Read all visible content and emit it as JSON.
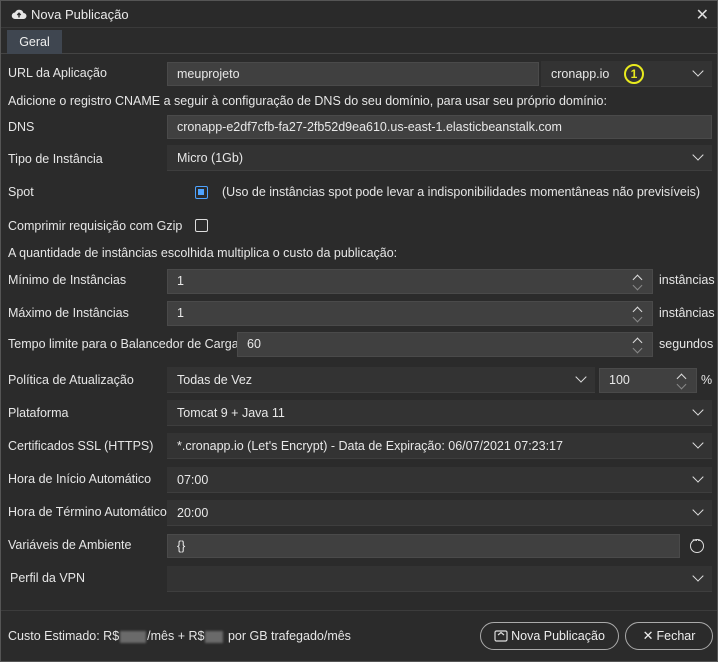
{
  "window": {
    "title": "Nova Publicação"
  },
  "tabs": [
    {
      "label": "Geral"
    }
  ],
  "app_url": {
    "label": "URL da Aplicação",
    "value": "meuprojeto",
    "domain": "cronapp.io",
    "badge": "1"
  },
  "cname_info": "Adicione o registro CNAME a seguir à configuração de DNS do seu domínio, para usar seu próprio domínio:",
  "dns": {
    "label": "DNS",
    "value": "cronapp-e2df7cfb-fa27-2fb52d9ea610.us-east-1.elasticbeanstalk.com"
  },
  "instance_type": {
    "label": "Tipo de Instância",
    "value": "Micro (1Gb)"
  },
  "spot": {
    "label": "Spot",
    "checked": true,
    "note": "(Uso de instâncias spot pode levar a indisponibilidades momentâneas não previsíveis)"
  },
  "gzip": {
    "label": "Comprimir requisição com Gzip",
    "checked": false
  },
  "quantity_info": "A quantidade de instâncias escolhida multiplica o custo da publicação:",
  "min_instances": {
    "label": "Mínimo de Instâncias",
    "value": "1",
    "unit": "instâncias"
  },
  "max_instances": {
    "label": "Máximo de Instâncias",
    "value": "1",
    "unit": "instâncias"
  },
  "lb_timeout": {
    "label": "Tempo limite para o Balancedor de Carga",
    "value": "60",
    "unit": "segundos"
  },
  "update_policy": {
    "label": "Política de Atualização",
    "value": "Todas de Vez",
    "percent": "100",
    "percent_unit": "%"
  },
  "platform": {
    "label": "Plataforma",
    "value": "Tomcat 9 + Java 11"
  },
  "ssl": {
    "label": "Certificados SSL (HTTPS)",
    "value": "*.cronapp.io (Let's Encrypt) - Data de Expiração: 06/07/2021 07:23:17"
  },
  "auto_start": {
    "label": "Hora de Início Automático",
    "value": "07:00"
  },
  "auto_end": {
    "label": "Hora de Término Automático",
    "value": "20:00"
  },
  "env_vars": {
    "label": "Variáveis de Ambiente",
    "value": "{}"
  },
  "vpn": {
    "label": "Perfil da VPN",
    "value": ""
  },
  "footer": {
    "cost_prefix": "Custo Estimado:  R$",
    "cost_mid": "/mês + R$",
    "cost_suffix": " por GB trafegado/mês",
    "publish_label": "Nova Publicação",
    "close_label": "Fechar"
  },
  "colors": {
    "background": "#2b2b2b",
    "field": "#404040",
    "tab": "#3f4650",
    "checkbox_on": "#4ea3ff",
    "badge": "#e8ea1e"
  }
}
